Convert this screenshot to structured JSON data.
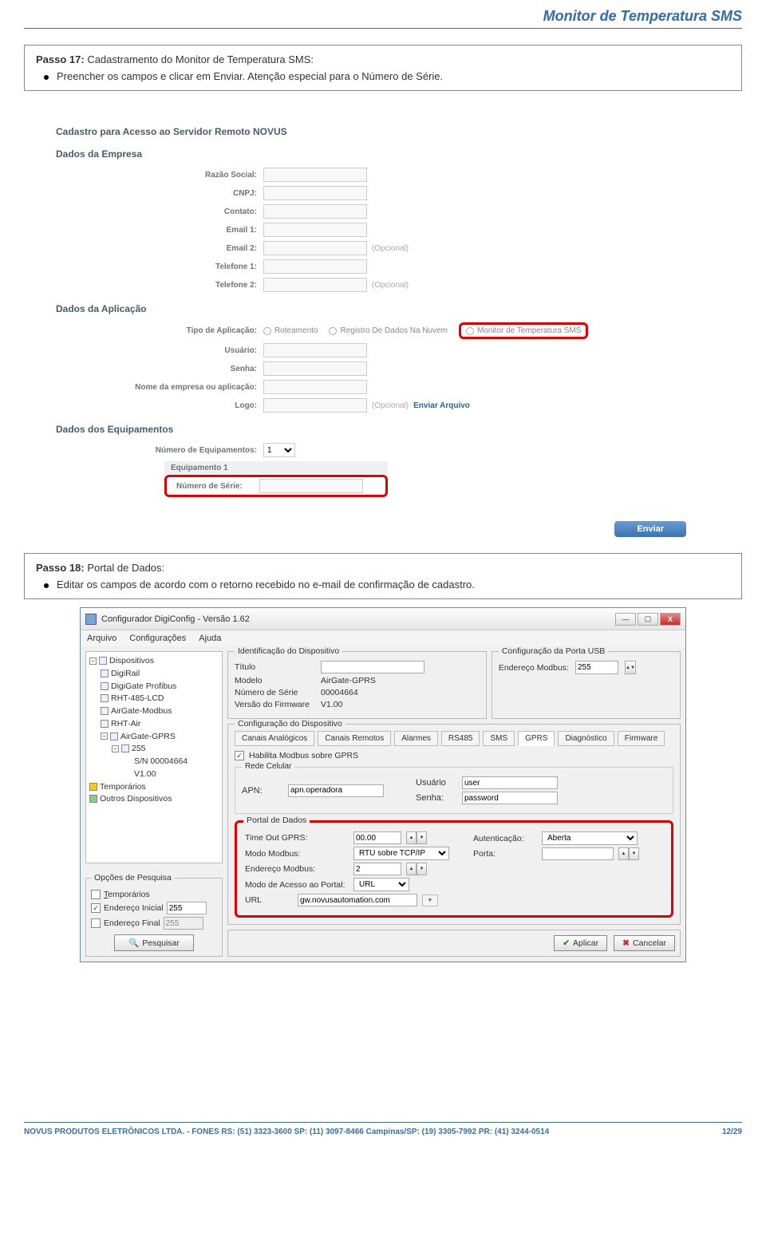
{
  "header": {
    "title": "Monitor de Temperatura SMS"
  },
  "step17": {
    "prefix": "Passo 17:",
    "title": " Cadastramento do Monitor de Temperatura SMS:",
    "bullet": "Preencher os campos e clicar em Enviar. Atenção especial para o Número de Série."
  },
  "webform": {
    "title": "Cadastro para Acesso ao Servidor Remoto NOVUS",
    "sections": {
      "empresa": {
        "title": "Dados da Empresa",
        "razao": "Razão Social:",
        "cnpj": "CNPJ:",
        "contato": "Contato:",
        "email1": "Email 1:",
        "email2": "Email 2:",
        "tel1": "Telefone 1:",
        "tel2": "Telefone 2:",
        "opcional": "(Opcional)"
      },
      "aplicacao": {
        "title": "Dados da Aplicação",
        "tipo": "Tipo de Aplicação:",
        "r1": "Roteamento",
        "r2": "Registro De Dados Na Nuvem",
        "r3": "Monitor de Temperatura SMS",
        "usuario": "Usuário:",
        "senha": "Senha:",
        "nome": "Nome da empresa ou aplicação:",
        "logo": "Logo:",
        "enviar_arq": "Enviar Arquivo"
      },
      "equip": {
        "title": "Dados dos Equipamentos",
        "numequip": "Número de Equipamentos:",
        "numequip_val": "1",
        "equip1": "Equipamento 1",
        "serial": "Número de Série:"
      }
    },
    "enviar": "Enviar"
  },
  "step18": {
    "prefix": "Passo 18:",
    "title": " Portal de Dados:",
    "bullet": "Editar os campos de acordo com o retorno recebido no e-mail de confirmação de cadastro."
  },
  "win": {
    "title": "Configurador DigiConfig - Versão 1.62",
    "menu": {
      "arquivo": "Arquivo",
      "config": "Configurações",
      "ajuda": "Ajuda"
    },
    "tree": {
      "disp": "Dispositivos",
      "digirail": "DigiRail",
      "digigate": "DigiGate Profibus",
      "rht485": "RHT-485-LCD",
      "airgate_mb": "AirGate-Modbus",
      "rhtair": "RHT-Air",
      "airgate_gprs": "AirGate-GPRS",
      "node255": "255",
      "sn": "S/N 00004664",
      "ver": "V1.00",
      "temp": "Temporários",
      "outros": "Outros Dispositivos"
    },
    "opcoes": {
      "title": "Opções de Pesquisa",
      "temp": "Temporários",
      "end_ini": "Endereço Inicial",
      "end_ini_val": "255",
      "end_fin": "Endereço Final",
      "end_fin_val": "255",
      "pesquisar": "Pesquisar"
    },
    "ident": {
      "title": "Identificação do Dispositivo",
      "titulo": "Título",
      "modelo_l": "Modelo",
      "modelo_v": "AirGate-GPRS",
      "numserie_l": "Número de Série",
      "numserie_v": "00004664",
      "firmware_l": "Versão do Firmware",
      "firmware_v": "V1.00"
    },
    "usb": {
      "title": "Configuração da Porta USB",
      "endereco": "Endereço Modbus:",
      "val": "255"
    },
    "conf": {
      "title": "Configuração do Dispositivo",
      "tabs": [
        "Canais Analógicos",
        "Canais Remotos",
        "Alarmes",
        "RS485",
        "SMS",
        "GPRS",
        "Diagnóstico",
        "Firmware"
      ],
      "habilita": "Habilita Modbus sobre GPRS"
    },
    "rede": {
      "title": "Rede Celular",
      "apn_l": "APN:",
      "apn_v": "apn.operadora",
      "usuario_l": "Usuário",
      "usuario_v": "user",
      "senha_l": "Senha:",
      "senha_v": "password"
    },
    "portal": {
      "title": "Portal de Dados",
      "timeout_l": "Time Out GPRS:",
      "timeout_v": "00.00",
      "modomb_l": "Modo Modbus:",
      "modomb_v": "RTU sobre TCP/IP",
      "endmb_l": "Endereço Modbus:",
      "endmb_v": "2",
      "modoacc_l": "Modo de Acesso ao Portal:",
      "modoacc_v": "URL",
      "url_l": "URL",
      "url_v": "gw.novusautomation.com",
      "auth_l": "Autenticação:",
      "auth_v": "Aberta",
      "porta_l": "Porta:",
      "plus": "+"
    },
    "footer": {
      "aplicar": "Aplicar",
      "cancelar": "Cancelar"
    }
  },
  "pagefooter": {
    "left": "NOVUS PRODUTOS ELETRÔNICOS LTDA. -  FONES  RS: (51) 3323-3600  SP: (11) 3097-8466  Campinas/SP: (19) 3305-7992  PR: (41) 3244-0514",
    "right": "12/29"
  }
}
